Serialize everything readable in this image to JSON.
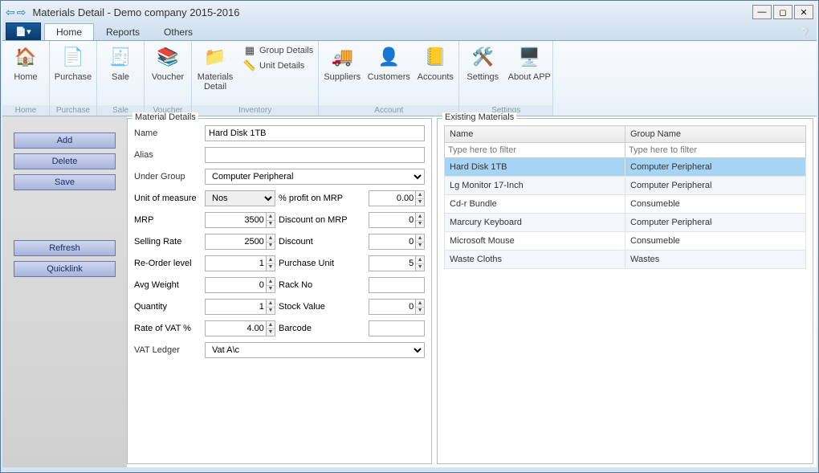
{
  "window": {
    "title": "Materials Detail - Demo company 2015-2016"
  },
  "tabs": {
    "home": "Home",
    "reports": "Reports",
    "others": "Others"
  },
  "ribbon": {
    "home": "Home",
    "purchase": "Purchase",
    "sale": "Sale",
    "voucher": "Voucher",
    "materials_detail": "Materials Detail",
    "group_details": "Group Details",
    "unit_details": "Unit Details",
    "suppliers": "Suppliers",
    "customers": "Customers",
    "accounts": "Accounts",
    "settings": "Settings",
    "about_app": "About APP",
    "grp_home": "Home",
    "grp_purchase": "Purchase",
    "grp_sale": "Sale",
    "grp_voucher": "Voucher",
    "grp_inventory": "Inventory",
    "grp_account": "Account",
    "grp_settings": "Settings"
  },
  "sidebar": {
    "add": "Add",
    "delete": "Delete",
    "save": "Save",
    "refresh": "Refresh",
    "quicklink": "Quicklink"
  },
  "details": {
    "legend": "Material Details",
    "labels": {
      "name": "Name",
      "alias": "Alias",
      "under_group": "Under Group",
      "unit_of_measure": "Unit of measure",
      "pct_profit_mrp": "% profit on MRP",
      "mrp": "MRP",
      "discount_mrp": "Discount on MRP",
      "selling_rate": "Selling Rate",
      "discount": "Discount",
      "reorder": "Re-Order level",
      "purchase_unit": "Purchase Unit",
      "avg_weight": "Avg Weight",
      "rack_no": "Rack No",
      "quantity": "Quantity",
      "stock_value": "Stock Value",
      "rate_vat": "Rate of VAT %",
      "barcode": "Barcode",
      "vat_ledger": "VAT Ledger"
    },
    "values": {
      "name": "Hard Disk 1TB",
      "alias": "",
      "under_group": "Computer Peripheral",
      "unit_of_measure": "Nos",
      "pct_profit_mrp": "0.00",
      "mrp": "3500",
      "discount_mrp": "0",
      "selling_rate": "2500",
      "discount": "0",
      "reorder": "1",
      "purchase_unit": "5",
      "avg_weight": "0",
      "rack_no": "",
      "quantity": "1",
      "stock_value": "0",
      "rate_vat": "4.00",
      "barcode": "",
      "vat_ledger": "Vat A\\c"
    }
  },
  "existing": {
    "legend": "Existing Materials",
    "headers": {
      "name": "Name",
      "group": "Group Name"
    },
    "filter_placeholder": "Type here to filter",
    "rows": [
      {
        "name": "Hard Disk 1TB",
        "group": "Computer Peripheral",
        "selected": true
      },
      {
        "name": "Lg Monitor 17-Inch",
        "group": "Computer Peripheral"
      },
      {
        "name": "Cd-r Bundle",
        "group": "Consumeble"
      },
      {
        "name": "Marcury Keyboard",
        "group": "Computer Peripheral"
      },
      {
        "name": "Microsoft Mouse",
        "group": "Consumeble"
      },
      {
        "name": "Waste Cloths",
        "group": "Wastes"
      }
    ]
  }
}
